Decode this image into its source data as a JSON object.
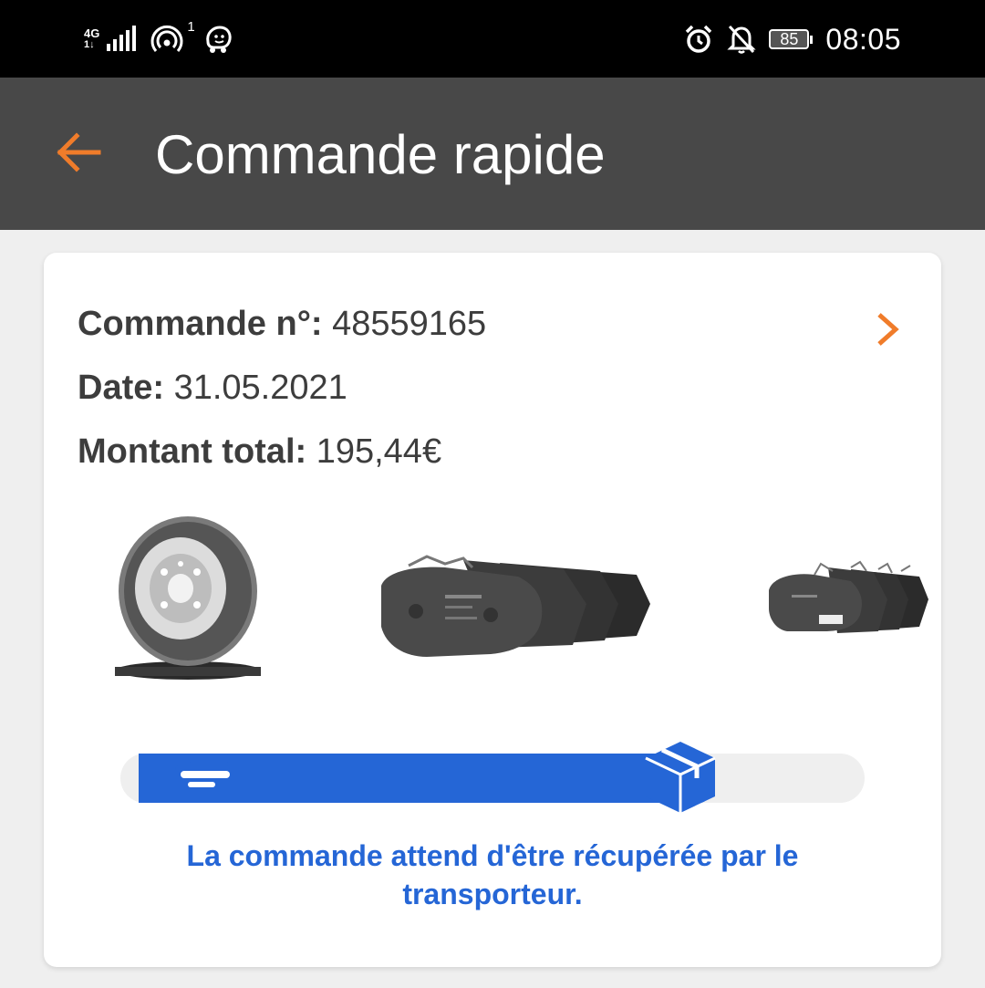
{
  "status_bar": {
    "network_type_top": "4G",
    "network_type_bottom": "1↓",
    "hotspot_count": "1",
    "battery": "85",
    "time": "08:05",
    "icons": [
      "signal-icon",
      "hotspot-icon",
      "waze-icon",
      "alarm-icon",
      "notifications-off-icon",
      "battery-icon"
    ]
  },
  "app_bar": {
    "title": "Commande rapide",
    "back_icon": "arrow-left-icon",
    "accent": "#f07c2a",
    "background": "#484848"
  },
  "order": {
    "number_label": "Commande n°:",
    "number": "48559165",
    "date_label": "Date:",
    "date": "31.05.2021",
    "total_label": "Montant total:",
    "total": "195,44€",
    "detail_icon": "chevron-right-icon"
  },
  "products": [
    {
      "icon": "brake-disc-image"
    },
    {
      "icon": "brake-pads-image"
    },
    {
      "icon": "brake-pads-small-image"
    }
  ],
  "progress": {
    "fraction": 0.79,
    "icon": "package-box-icon",
    "color": "#2566d6"
  },
  "status_message": "La commande attend d'être récupérée par le transporteur."
}
